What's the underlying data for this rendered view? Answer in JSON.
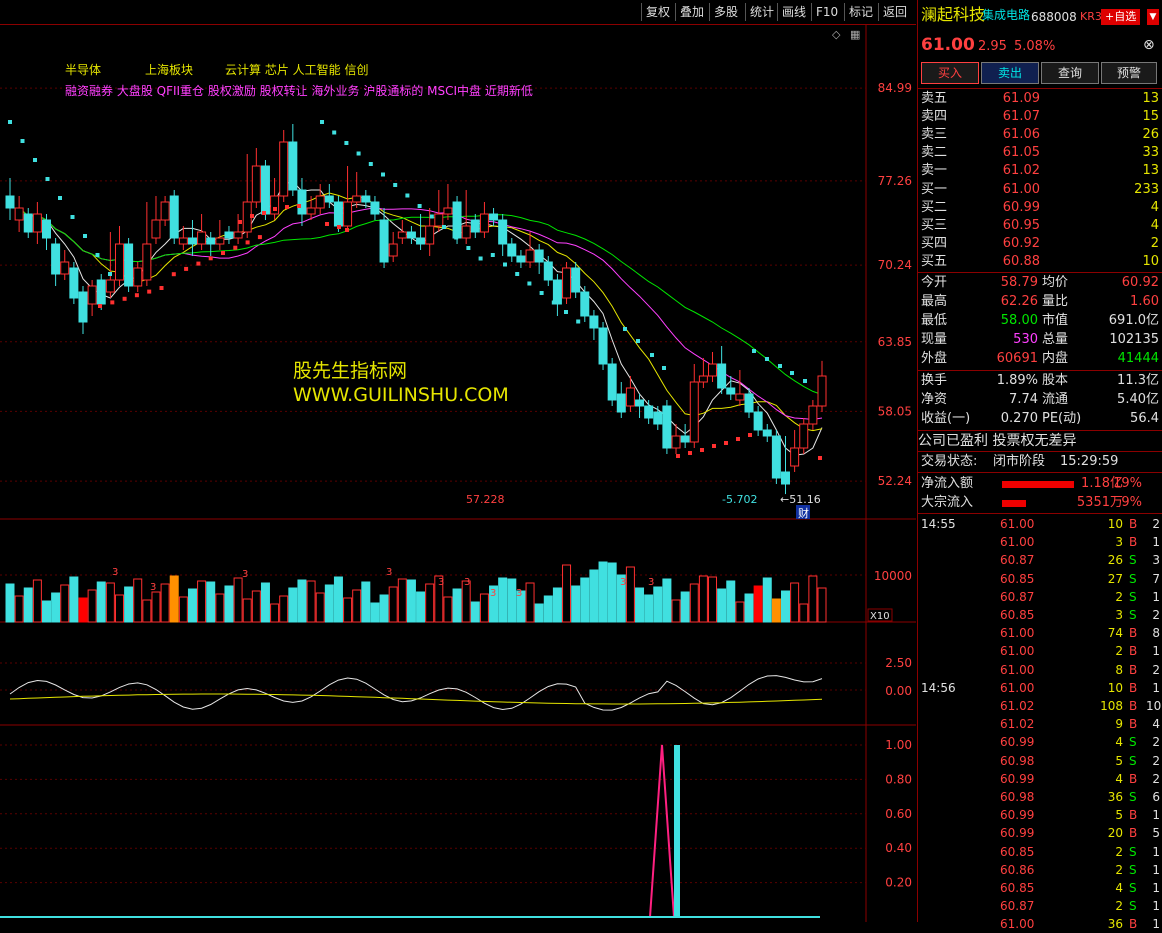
{
  "toolbar": {
    "buttons": [
      "复权",
      "叠加",
      "多股",
      "统计",
      "画线",
      "F10",
      "标记",
      "返回"
    ]
  },
  "stock": {
    "name": "澜起科技",
    "sector": "集成电路",
    "code": "688008",
    "market": "KR3",
    "add_label": "+自选",
    "price": "61.00",
    "change": "2.95",
    "change_pct": "5.08%"
  },
  "actions": {
    "buy": "买入",
    "sell": "卖出",
    "query": "查询",
    "alert": "预警"
  },
  "asks": [
    {
      "label": "卖五",
      "price": "61.09",
      "vol": "13"
    },
    {
      "label": "卖四",
      "price": "61.07",
      "vol": "15"
    },
    {
      "label": "卖三",
      "price": "61.06",
      "vol": "26"
    },
    {
      "label": "卖二",
      "price": "61.05",
      "vol": "33"
    },
    {
      "label": "卖一",
      "price": "61.02",
      "vol": "13"
    }
  ],
  "bids": [
    {
      "label": "买一",
      "price": "61.00",
      "vol": "233"
    },
    {
      "label": "买二",
      "price": "60.99",
      "vol": "4"
    },
    {
      "label": "买三",
      "price": "60.95",
      "vol": "4"
    },
    {
      "label": "买四",
      "price": "60.92",
      "vol": "2"
    },
    {
      "label": "买五",
      "price": "60.88",
      "vol": "10"
    }
  ],
  "quote": [
    {
      "l1": "今开",
      "v1": "58.79",
      "c1": "red",
      "l2": "均价",
      "v2": "60.92",
      "c2": "red"
    },
    {
      "l1": "最高",
      "v1": "62.26",
      "c1": "red",
      "l2": "量比",
      "v2": "1.60",
      "c2": "red"
    },
    {
      "l1": "最低",
      "v1": "58.00",
      "c1": "green",
      "l2": "市值",
      "v2": "691.0亿",
      "c2": "white"
    },
    {
      "l1": "现量",
      "v1": "530",
      "c1": "magenta",
      "l2": "总量",
      "v2": "102135",
      "c2": "white"
    },
    {
      "l1": "外盘",
      "v1": "60691",
      "c1": "red",
      "l2": "内盘",
      "v2": "41444",
      "c2": "green"
    }
  ],
  "fundamentals": [
    {
      "l1": "换手",
      "v1": "1.89%",
      "l2": "股本",
      "v2": "11.3亿"
    },
    {
      "l1": "净资",
      "v1": "7.74",
      "l2": "流通",
      "v2": "5.40亿"
    },
    {
      "l1": "收益(一)",
      "v1": "0.270",
      "l2": "PE(动)",
      "v2": "56.4"
    }
  ],
  "profit_note": "公司已盈利 投票权无差异",
  "trade_status": {
    "label": "交易状态:",
    "value": "闭市阶段",
    "time": "15:29:59"
  },
  "flows": [
    {
      "label": "净流入额",
      "value": "1.18亿",
      "pct": "19%"
    },
    {
      "label": "大宗流入",
      "value": "5351万",
      "pct": "9%"
    }
  ],
  "ticks": [
    {
      "time": "14:55",
      "price": "61.00",
      "vol": "10",
      "side": "B",
      "n": "2"
    },
    {
      "time": "",
      "price": "61.00",
      "vol": "3",
      "side": "B",
      "n": "1"
    },
    {
      "time": "",
      "price": "60.87",
      "vol": "26",
      "side": "S",
      "n": "3"
    },
    {
      "time": "",
      "price": "60.85",
      "vol": "27",
      "side": "S",
      "n": "7"
    },
    {
      "time": "",
      "price": "60.87",
      "vol": "2",
      "side": "S",
      "n": "1"
    },
    {
      "time": "",
      "price": "60.85",
      "vol": "3",
      "side": "S",
      "n": "2"
    },
    {
      "time": "",
      "price": "61.00",
      "vol": "74",
      "side": "B",
      "n": "8"
    },
    {
      "time": "",
      "price": "61.00",
      "vol": "2",
      "side": "B",
      "n": "1"
    },
    {
      "time": "",
      "price": "61.00",
      "vol": "8",
      "side": "B",
      "n": "2"
    },
    {
      "time": "14:56",
      "price": "61.00",
      "vol": "10",
      "side": "B",
      "n": "1"
    },
    {
      "time": "",
      "price": "61.02",
      "vol": "108",
      "side": "B",
      "n": "10"
    },
    {
      "time": "",
      "price": "61.02",
      "vol": "9",
      "side": "B",
      "n": "4"
    },
    {
      "time": "",
      "price": "60.99",
      "vol": "4",
      "side": "S",
      "n": "2"
    },
    {
      "time": "",
      "price": "60.98",
      "vol": "5",
      "side": "S",
      "n": "2"
    },
    {
      "time": "",
      "price": "60.99",
      "vol": "4",
      "side": "B",
      "n": "2"
    },
    {
      "time": "",
      "price": "60.98",
      "vol": "36",
      "side": "S",
      "n": "6"
    },
    {
      "time": "",
      "price": "60.99",
      "vol": "5",
      "side": "B",
      "n": "1"
    },
    {
      "time": "",
      "price": "60.99",
      "vol": "20",
      "side": "B",
      "n": "5"
    },
    {
      "time": "",
      "price": "60.85",
      "vol": "2",
      "side": "S",
      "n": "1"
    },
    {
      "time": "",
      "price": "60.86",
      "vol": "2",
      "side": "S",
      "n": "1"
    },
    {
      "time": "",
      "price": "60.85",
      "vol": "4",
      "side": "S",
      "n": "1"
    },
    {
      "time": "",
      "price": "60.87",
      "vol": "2",
      "side": "S",
      "n": "1"
    },
    {
      "time": "",
      "price": "61.00",
      "vol": "36",
      "side": "B",
      "n": "1"
    }
  ],
  "chart": {
    "tags1": [
      "半导体",
      "上海板块",
      "云计算 芯片 人工智能 信创"
    ],
    "tags2": "融资融券 大盘股 QFII重仓 股权激励 股权转让 海外业务 沪股通标的 MSCI中盘 近期新低",
    "watermark1": "股先生指标网",
    "watermark2": "WWW.GUILINSHU.COM",
    "price_axis": [
      "84.99",
      "77.26",
      "70.24",
      "63.85",
      "58.05",
      "52.24"
    ],
    "price_ticks": [
      84.99,
      77.26,
      70.24,
      63.85,
      58.05,
      52.24
    ],
    "annot_high": "57.228",
    "annot_low": "-5.702",
    "annot_min": "51.16",
    "annot_cai": "财",
    "vol_axis": "10000",
    "vol_unit": "X10",
    "osc_axis": [
      "2.50",
      "0.00"
    ],
    "sig_axis": [
      "1.00",
      "0.80",
      "0.60",
      "0.40",
      "0.20"
    ]
  },
  "chart_data": {
    "type": "candlestick",
    "ylim": [
      50.5,
      88.0
    ],
    "candles": [
      [
        76.0,
        75.0,
        77.5,
        74.0
      ],
      [
        74.0,
        75.0,
        76.0,
        73.0
      ],
      [
        74.5,
        73.0,
        75.0,
        72.5
      ],
      [
        73.0,
        74.5,
        75.5,
        72.0
      ],
      [
        74.0,
        72.5,
        74.5,
        71.5
      ],
      [
        72.0,
        69.5,
        72.5,
        68.5
      ],
      [
        69.5,
        70.5,
        71.5,
        69.0
      ],
      [
        70.0,
        67.5,
        70.5,
        67.0
      ],
      [
        68.0,
        65.5,
        68.5,
        64.5
      ],
      [
        67.0,
        68.5,
        69.0,
        66.0
      ],
      [
        69.0,
        67.0,
        69.5,
        66.5
      ],
      [
        68.0,
        69.0,
        73.0,
        67.5
      ],
      [
        69.0,
        72.0,
        73.5,
        68.5
      ],
      [
        72.0,
        68.5,
        72.5,
        68.0
      ],
      [
        68.5,
        70.0,
        70.5,
        68.0
      ],
      [
        69.0,
        72.0,
        75.5,
        68.5
      ],
      [
        72.5,
        74.0,
        76.0,
        72.0
      ],
      [
        74.0,
        75.5,
        76.0,
        73.5
      ],
      [
        76.0,
        72.5,
        76.5,
        72.0
      ],
      [
        72.0,
        72.5,
        73.5,
        71.5
      ],
      [
        72.5,
        72.0,
        74.0,
        71.0
      ],
      [
        72.0,
        73.0,
        74.5,
        71.5
      ],
      [
        72.5,
        72.0,
        73.0,
        71.0
      ],
      [
        72.0,
        72.5,
        74.0,
        71.5
      ],
      [
        73.0,
        72.5,
        73.5,
        72.0
      ],
      [
        72.5,
        73.0,
        74.5,
        72.0
      ],
      [
        73.0,
        75.5,
        79.5,
        72.5
      ],
      [
        75.5,
        78.5,
        80.0,
        75.0
      ],
      [
        78.5,
        74.5,
        79.0,
        74.0
      ],
      [
        74.5,
        76.0,
        77.5,
        74.0
      ],
      [
        76.0,
        80.5,
        81.5,
        75.5
      ],
      [
        80.5,
        76.5,
        82.0,
        76.0
      ],
      [
        76.5,
        74.5,
        77.5,
        73.5
      ],
      [
        74.5,
        75.0,
        76.0,
        74.0
      ],
      [
        75.0,
        76.0,
        77.0,
        74.5
      ],
      [
        76.0,
        75.5,
        77.0,
        75.0
      ],
      [
        75.5,
        73.5,
        76.0,
        73.0
      ],
      [
        73.5,
        75.5,
        78.5,
        73.0
      ],
      [
        75.5,
        76.0,
        78.0,
        75.0
      ],
      [
        76.0,
        75.5,
        76.5,
        75.0
      ],
      [
        75.5,
        74.5,
        76.0,
        74.0
      ],
      [
        74.0,
        70.5,
        75.0,
        70.0
      ],
      [
        71.0,
        72.0,
        73.0,
        70.5
      ],
      [
        72.5,
        73.0,
        74.0,
        72.0
      ],
      [
        73.0,
        72.5,
        73.5,
        72.0
      ],
      [
        72.5,
        72.0,
        74.5,
        71.5
      ],
      [
        72.0,
        73.5,
        75.0,
        71.0
      ],
      [
        73.5,
        74.5,
        76.5,
        73.0
      ],
      [
        74.5,
        75.0,
        77.0,
        74.0
      ],
      [
        75.5,
        72.5,
        76.0,
        72.0
      ],
      [
        72.5,
        73.5,
        76.5,
        72.0
      ],
      [
        74.0,
        73.0,
        74.5,
        72.5
      ],
      [
        73.0,
        74.5,
        75.5,
        72.5
      ],
      [
        74.5,
        74.0,
        75.0,
        73.5
      ],
      [
        74.0,
        72.0,
        74.5,
        71.0
      ],
      [
        72.0,
        71.0,
        72.5,
        70.5
      ],
      [
        71.0,
        70.5,
        71.5,
        70.0
      ],
      [
        70.5,
        71.5,
        73.0,
        70.0
      ],
      [
        71.5,
        70.5,
        72.0,
        69.5
      ],
      [
        70.5,
        69.0,
        71.0,
        68.5
      ],
      [
        69.0,
        67.0,
        69.5,
        66.0
      ],
      [
        67.5,
        70.0,
        70.5,
        67.0
      ],
      [
        70.0,
        68.0,
        70.5,
        67.5
      ],
      [
        68.0,
        66.0,
        68.5,
        65.5
      ],
      [
        66.0,
        65.0,
        66.5,
        64.0
      ],
      [
        65.0,
        62.0,
        65.5,
        61.5
      ],
      [
        62.0,
        59.0,
        62.5,
        58.5
      ],
      [
        59.5,
        58.0,
        60.5,
        57.5
      ],
      [
        58.5,
        60.0,
        61.0,
        58.0
      ],
      [
        59.0,
        58.5,
        59.5,
        57.5
      ],
      [
        58.5,
        57.5,
        59.0,
        57.0
      ],
      [
        58.0,
        57.0,
        58.5,
        56.5
      ],
      [
        58.5,
        55.0,
        59.0,
        54.5
      ],
      [
        55.0,
        56.0,
        57.0,
        54.5
      ],
      [
        56.0,
        55.5,
        57.0,
        55.0
      ],
      [
        55.5,
        60.5,
        62.0,
        55.0
      ],
      [
        60.5,
        61.0,
        62.5,
        60.0
      ],
      [
        61.0,
        62.0,
        63.0,
        60.5
      ],
      [
        62.0,
        60.0,
        63.5,
        59.5
      ],
      [
        60.0,
        59.5,
        61.0,
        59.0
      ],
      [
        59.0,
        59.5,
        61.5,
        58.5
      ],
      [
        59.5,
        58.0,
        60.0,
        57.5
      ],
      [
        58.0,
        56.5,
        58.5,
        56.0
      ],
      [
        56.5,
        56.0,
        57.0,
        55.5
      ],
      [
        56.0,
        52.5,
        56.5,
        52.0
      ],
      [
        53.0,
        52.0,
        56.0,
        51.16
      ],
      [
        53.5,
        55.0,
        56.5,
        53.0
      ],
      [
        55.0,
        57.0,
        57.5,
        54.5
      ],
      [
        57.0,
        58.5,
        59.0,
        56.5
      ],
      [
        58.5,
        61.0,
        62.26,
        58.0
      ]
    ]
  }
}
